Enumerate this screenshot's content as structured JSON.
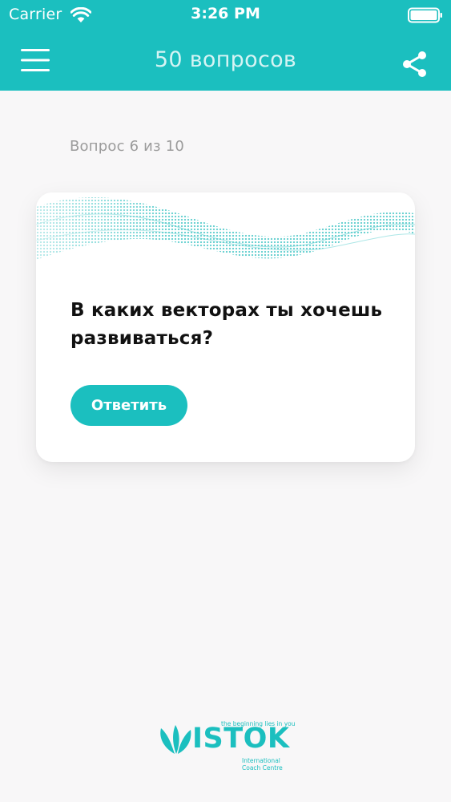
{
  "status_bar": {
    "carrier": "Carrier",
    "time": "3:26 PM"
  },
  "nav": {
    "title": "50 вопросов",
    "menu_icon": "hamburger-menu-icon",
    "share_icon": "share-icon"
  },
  "quiz": {
    "counter": "Вопрос 6 из 10",
    "question": "В каких векторах ты хочешь развиваться?",
    "answer_button": "Ответить"
  },
  "logo": {
    "tagline": "the beginning lies in you",
    "wordmark": "ISTOK",
    "subtitle_line1": "International",
    "subtitle_line2": "Coach Centre"
  },
  "colors": {
    "accent": "#1bbfbf",
    "background": "#f8f7f8",
    "card": "#ffffff",
    "question_text": "#111111",
    "muted_text": "#9b9b9b"
  }
}
